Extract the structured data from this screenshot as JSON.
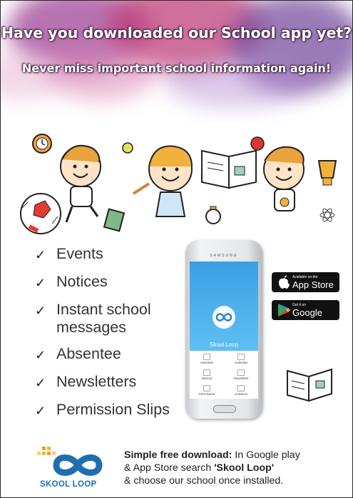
{
  "headline": "Have you downloaded our School app yet?",
  "subheadline": "Never miss important school information again!",
  "features": [
    {
      "label": "Events"
    },
    {
      "label": "Notices"
    },
    {
      "label": "Instant school messages"
    },
    {
      "label": "Absentee"
    },
    {
      "label": "Newsletters"
    },
    {
      "label": "Permission Slips"
    }
  ],
  "phone": {
    "brand": "SAMSUNG",
    "app_title": "Skool Loop",
    "menu": [
      "Absentee",
      "Calendar",
      "Notices",
      "Newsletter",
      "Permission",
      "Contacts"
    ]
  },
  "stores": {
    "apple_small": "Available on the",
    "apple_big": "App Store",
    "google_small": "Get it on",
    "google_big": "Google play"
  },
  "footer": {
    "bold1": "Simple free download:",
    "line1_rest": " In Google play",
    "line2_pre": "& App Store search ",
    "bold2": "'Skool Loop'",
    "line3": "& choose our school once installed.",
    "brand": "SKOOL LOOP"
  },
  "colors": {
    "accent": "#3aa0e4",
    "brand_blue": "#1f6fb0",
    "splash_purple": "#8a3f8c",
    "splash_pink": "#d6457f"
  }
}
